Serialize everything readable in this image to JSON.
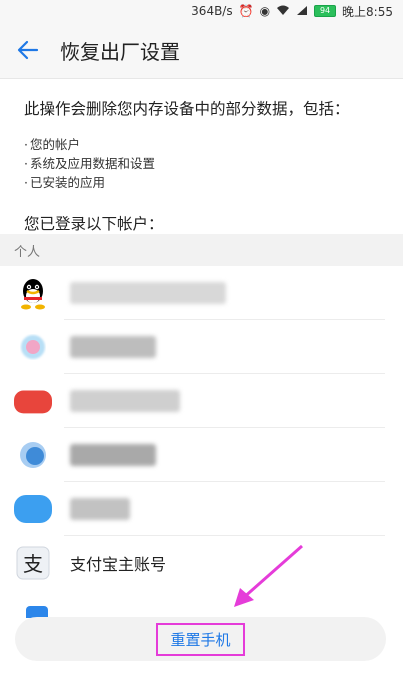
{
  "status_bar": {
    "network_speed": "364B/s",
    "alarm_icon": "alarm-icon",
    "eye_icon": "eye-icon",
    "wifi_icon": "wifi-icon",
    "signal_icon": "signal-icon",
    "battery_level": "94",
    "time": "晚上8:55"
  },
  "header": {
    "back_icon": "back-arrow-icon",
    "title": "恢复出厂设置"
  },
  "intro": {
    "text": "此操作会删除您内存设备中的部分数据，包括：",
    "bullets": [
      "您的帐户",
      "系统及应用数据和设置",
      "已安装的应用"
    ]
  },
  "accounts_section": {
    "heading": "您已登录以下帐户：",
    "group_label": "个人",
    "items": [
      {
        "icon": "qq-icon",
        "color": "#000000"
      },
      {
        "icon": "blurred-app-icon",
        "color": "#6fb7e8"
      },
      {
        "icon": "blurred-app-icon",
        "color": "#e8453c"
      },
      {
        "icon": "blurred-app-icon",
        "color": "#3f8bd8"
      },
      {
        "icon": "blurred-app-icon",
        "color": "#3c9ff0"
      },
      {
        "icon": "alipay-icon",
        "label": "支付宝主账号",
        "color": "#1677ff"
      }
    ]
  },
  "footer": {
    "reset_label": "重置手机",
    "annotation_color": "#e53cd9"
  },
  "colors": {
    "accent": "#1e78e6",
    "highlight": "#e53cd9"
  }
}
